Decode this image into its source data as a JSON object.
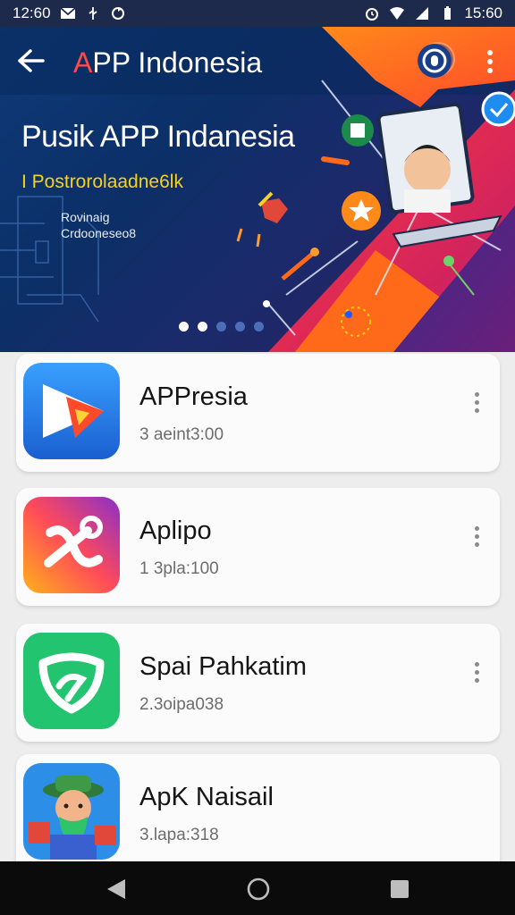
{
  "status_bar": {
    "time_left": "12:60",
    "time_right": "15:60",
    "icons_left": [
      "mail-icon",
      "usb-icon",
      "sync-icon"
    ],
    "icons_right": [
      "alarm-icon",
      "wifi-icon",
      "signal-icon",
      "battery-icon"
    ]
  },
  "app_bar": {
    "title_first": "A",
    "title_rest": "PP Indonesia",
    "icons": [
      "back-arrow-icon",
      "account-icon",
      "more-vert-icon"
    ]
  },
  "banner": {
    "heading": "Pusik APP Indanesia",
    "subheading": "I Postrorolaadne6lk",
    "caption_line1": "Rovinaig",
    "caption_line2": "Crdooneseo8",
    "slide_count": 5,
    "active_slide": 1
  },
  "apps": [
    {
      "name": "APPresia",
      "meta": "3 aeint3:00",
      "icon": "play-arrow-app-icon",
      "colors": [
        "#2d8cf0",
        "#1a5fd0"
      ]
    },
    {
      "name": "Aplipo",
      "meta": "1 3pla:100",
      "icon": "gradient-app-icon",
      "colors": [
        "#ff9a2e",
        "#c2289a"
      ]
    },
    {
      "name": "Spai Pahkatim",
      "meta": "2.3oipa038",
      "icon": "shield-app-icon",
      "colors": [
        "#2fcf7a",
        "#17b06a"
      ]
    },
    {
      "name": "ApK Naisail",
      "meta": "3.lapa:318",
      "icon": "character-app-icon",
      "colors": [
        "#3aa4f2",
        "#2180d8"
      ]
    }
  ],
  "nav_bar": {
    "icons": [
      "back-triangle-icon",
      "home-circle-icon",
      "recents-square-icon"
    ]
  },
  "colors": {
    "status_bar_bg": "#1e2a4c",
    "banner_bg": "#0e3a78",
    "accent_orange": "#ff6a1a",
    "accent_yellow": "#f7d21b",
    "list_bg": "#ededed"
  }
}
